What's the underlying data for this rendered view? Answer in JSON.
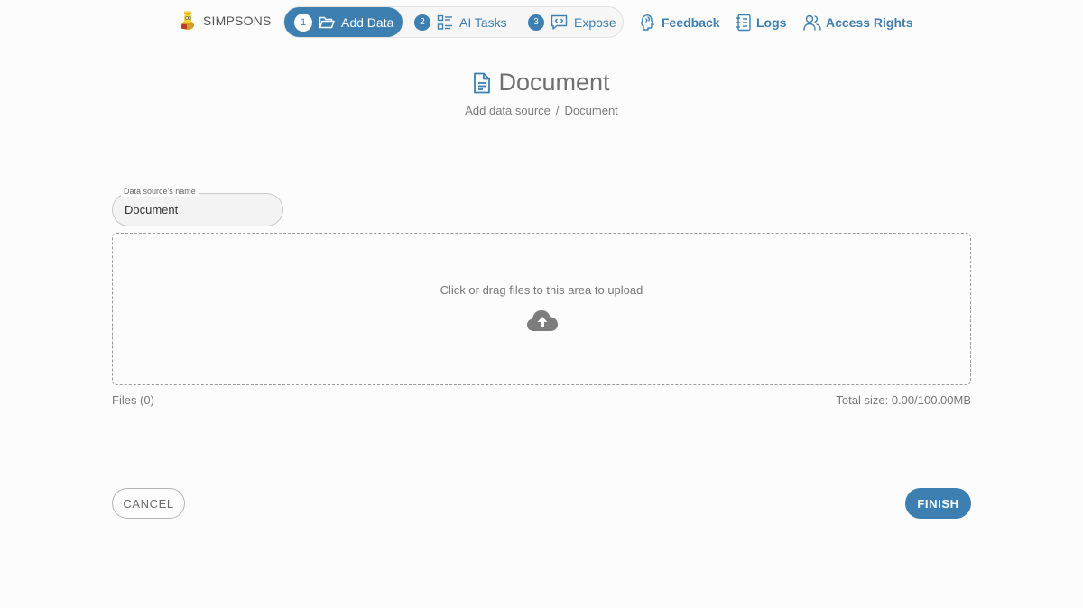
{
  "brand": {
    "name": "SIMPSONS",
    "icon": "simpsons-character-logo"
  },
  "steps": [
    {
      "number": "1",
      "label": "Add Data",
      "icon": "folder-open-icon",
      "active": true
    },
    {
      "number": "2",
      "label": "AI Tasks",
      "icon": "task-list-icon",
      "active": false
    },
    {
      "number": "3",
      "label": "Expose",
      "icon": "code-bubble-icon",
      "active": false
    }
  ],
  "nav": {
    "feedback": {
      "label": "Feedback",
      "icon": "brain-icon"
    },
    "logs": {
      "label": "Logs",
      "icon": "notebook-icon"
    },
    "access_rights": {
      "label": "Access Rights",
      "icon": "users-icon"
    }
  },
  "page": {
    "title": "Document",
    "title_icon": "document-icon",
    "breadcrumb": [
      "Add data source",
      "/",
      "Document"
    ]
  },
  "form": {
    "name_label": "Data source's name",
    "name_value": "Document"
  },
  "upload": {
    "prompt": "Click or drag files to this area to upload",
    "icon": "cloud-upload-icon",
    "files_count": "Files (0)",
    "total_size": "Total size: 0.00/100.00MB"
  },
  "actions": {
    "cancel": "CANCEL",
    "finish": "FINISH"
  },
  "colors": {
    "accent": "#3d7fb1",
    "background": "#fcfcfc",
    "text": "#6f6f6f"
  }
}
